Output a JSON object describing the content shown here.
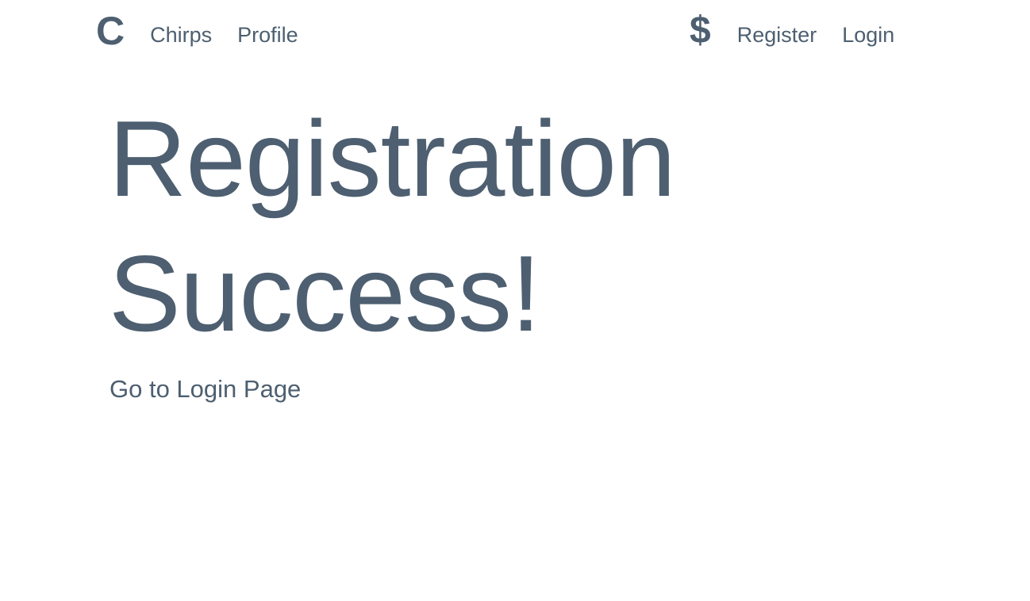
{
  "navbar": {
    "brand": "C",
    "left_links": [
      "Chirps",
      "Profile"
    ],
    "right_icon": "$",
    "right_links": [
      "Register",
      "Login"
    ]
  },
  "main": {
    "headline_line1": "Registration",
    "headline_line2": "Success!",
    "login_link": "Go to Login Page"
  },
  "colors": {
    "text": "#4d5f70",
    "background": "#ffffff"
  }
}
